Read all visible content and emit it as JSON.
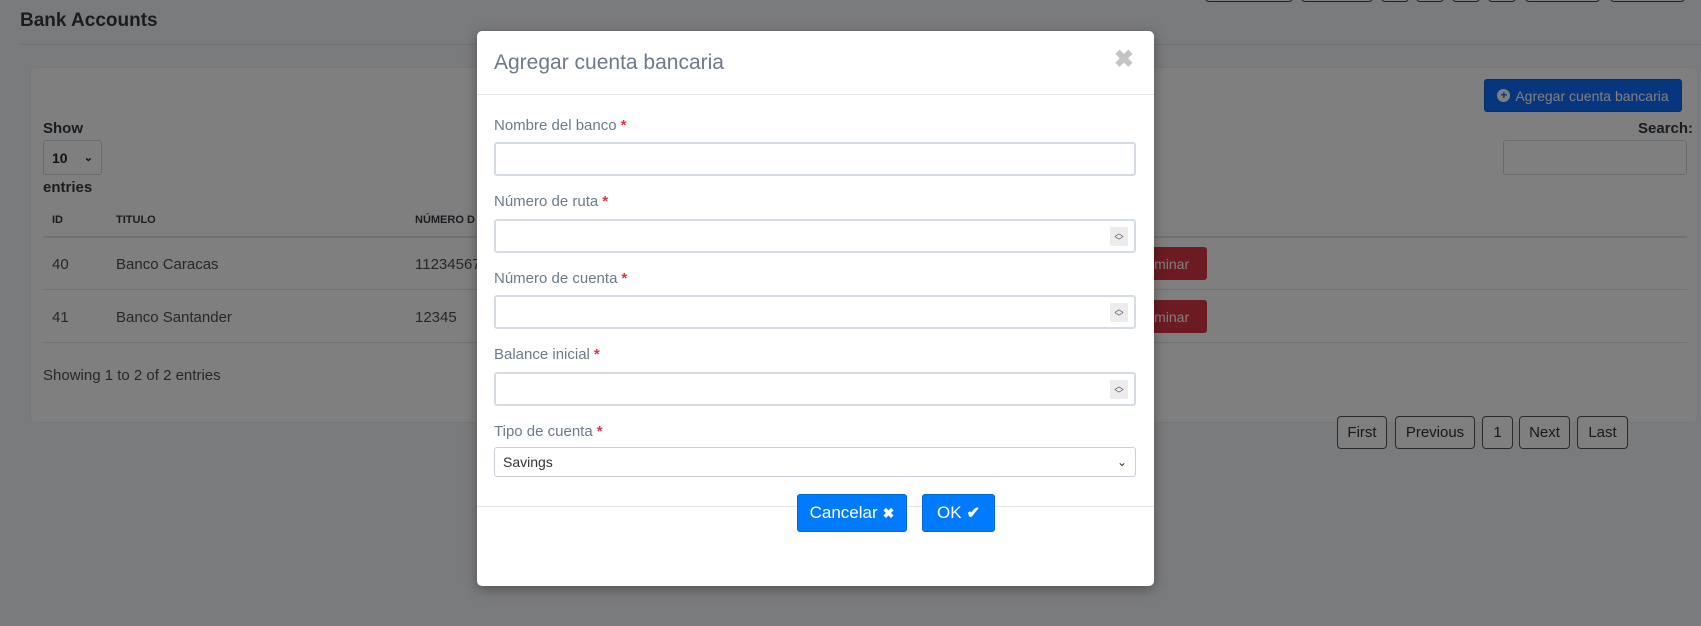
{
  "page": {
    "title": "Bank Accounts"
  },
  "toolbar": {
    "add_account_label": "Agregar cuenta bancaria"
  },
  "table_controls": {
    "show_label": "Show",
    "entries_per_page": "10",
    "entries_label": "entries",
    "search_label": "Search:"
  },
  "table": {
    "columns": [
      "ID",
      "TITULO",
      "NÚMERO D"
    ],
    "rows": [
      {
        "id": "40",
        "title": "Banco Caracas",
        "number": "11234567"
      },
      {
        "id": "41",
        "title": "Banco Santander",
        "number": "12345"
      }
    ],
    "row_action_label": "liminar",
    "info": "Showing 1 to 2 of 2 entries"
  },
  "pagination": {
    "first": "First",
    "previous": "Previous",
    "current": "1",
    "next": "Next",
    "last": "Last"
  },
  "modal": {
    "title": "Agregar cuenta bancaria",
    "close_glyph": "✖",
    "required_mark": "*",
    "fields": {
      "bank_name": {
        "label": "Nombre del banco",
        "value": ""
      },
      "routing_number": {
        "label": "Número de ruta",
        "value": ""
      },
      "account_number": {
        "label": "Número de cuenta",
        "value": ""
      },
      "opening_balance": {
        "label": "Balance inicial",
        "value": ""
      },
      "account_type": {
        "label": "Tipo de cuenta",
        "selected": "Savings"
      }
    },
    "cancel_label": "Cancelar",
    "ok_label": "OK"
  },
  "colors": {
    "primary": "#007bff",
    "danger": "#dc3545",
    "required": "#dc3545",
    "label_gray": "#6c7a89"
  },
  "icons": {
    "close": "times-icon",
    "cancel": "x-icon",
    "ok": "check-icon",
    "add": "plus-circle-icon"
  }
}
